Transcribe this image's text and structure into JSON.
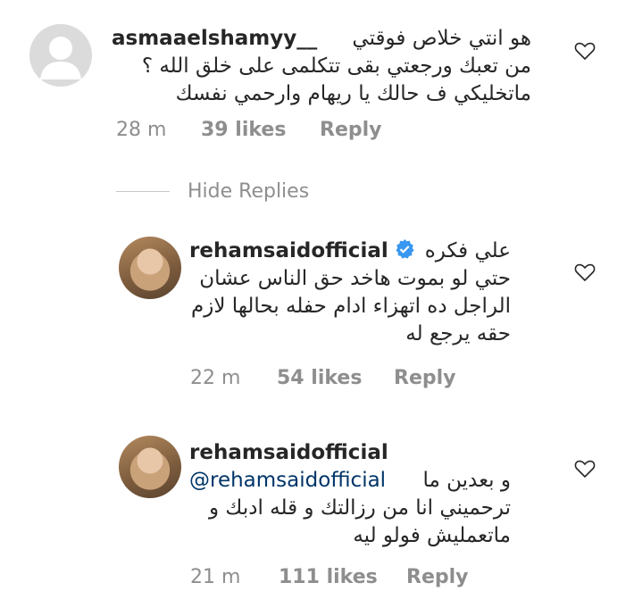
{
  "comments": [
    {
      "username": "asmaaelshamyy__",
      "lines": [
        "هو انتي خلاص فوقتي",
        "من تعبك ورجعتي بقى تتكلمى على خلق الله ؟",
        "ماتخليكي ف حالك يا ريهام وارحمي نفسك"
      ],
      "time": "28 m",
      "likes": "39 likes",
      "reply": "Reply"
    },
    {
      "username": "rehamsaidofficial",
      "verified": true,
      "lines": [
        "علي فكره",
        "حتي لو بموت هاخد حق الناس عشان",
        "الراجل ده اتهزاء ادام حفله بحالها لازم",
        "حقه يرجع له"
      ],
      "time": "22 m",
      "likes": "54 likes",
      "reply": "Reply"
    },
    {
      "username": "rehamsaidofficial",
      "mention": "@rehamsaidofficial",
      "lines": [
        "و بعدين ما",
        "ترحميني انا من رزالتك و قله ادبك و",
        "ماتعمليش فولو ليه"
      ],
      "time": "21 m",
      "likes": "111 likes",
      "reply": "Reply"
    }
  ],
  "hide_replies": "Hide Replies",
  "colors": {
    "text": "#262626",
    "meta": "#8e8e8e",
    "mention": "#003569",
    "verified": "#3897f0"
  }
}
